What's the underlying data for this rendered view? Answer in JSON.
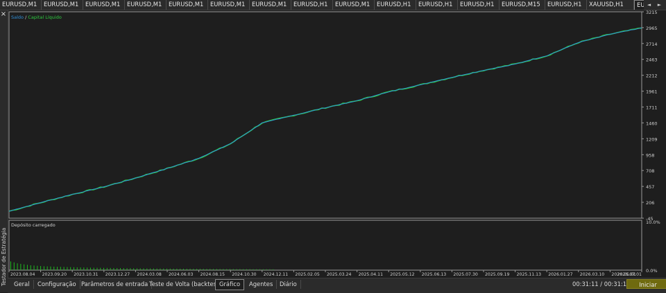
{
  "chart_tabs": [
    "EURUSD,M1",
    "EURUSD,M1",
    "EURUSD,M1",
    "EURUSD,M1",
    "EURUSD,M1",
    "EURUSD,M1",
    "EURUSD,M1",
    "EURUSD,H1",
    "EURUSD,M1",
    "EURUSD,H1",
    "EURUSD,H1",
    "EURUSD,H1",
    "EURUSD,M15",
    "EURUSD,H1",
    "XAUUSD,H1",
    "EUF"
  ],
  "active_chart_tab": 15,
  "nav": {
    "left": "◄",
    "right": "►"
  },
  "close_label": "×",
  "side_title": "Testador de Estratégia",
  "chart_data": [
    {
      "type": "line",
      "legend": [
        "Saldo",
        "Capital Líquido"
      ],
      "legend_sep": "/",
      "colors": {
        "balance": "#2f8fd8",
        "equity": "#2ecc40"
      },
      "y_ticks": [
        "3215",
        "2965",
        "2714",
        "2463",
        "2212",
        "1961",
        "1711",
        "1460",
        "1209",
        "958",
        "708",
        "457",
        "206",
        "-45"
      ],
      "ylim": [
        -45,
        3215
      ],
      "x_ticks": [
        "2023.08.04",
        "2023.09.20",
        "2023.10.31",
        "2023.12.27",
        "2024.03.08",
        "2024.06.03",
        "2024.08.15",
        "2024.10.30",
        "2024.12.11",
        "2025.02.05",
        "2025.03.24",
        "2025.04.11",
        "2025.05.12",
        "2025.06.13",
        "2025.07.30",
        "2025.09.19",
        "2025.11.13",
        "2026.01.27",
        "2026.03.10",
        "2026.05.01",
        "2026.07.01"
      ],
      "x": [
        0,
        1,
        2,
        3,
        4,
        5,
        6,
        7,
        8,
        9,
        10,
        11,
        12,
        13,
        14,
        15,
        16,
        17,
        18,
        19,
        20
      ],
      "values": [
        65,
        200,
        330,
        450,
        590,
        740,
        900,
        1130,
        1460,
        1580,
        1700,
        1810,
        1950,
        2060,
        2180,
        2290,
        2390,
        2520,
        2730,
        2860,
        2960
      ],
      "xlim": [
        0,
        20
      ]
    },
    {
      "type": "bar",
      "title": "Depósito carregado",
      "y_ticks": [
        "10.0%",
        "0.0%"
      ],
      "ylim": [
        0,
        10
      ],
      "color": "#1fb81f",
      "values": [
        1.8,
        1.6,
        1.4,
        1.3,
        1.2,
        1.1,
        1.0,
        0.95,
        0.9,
        0.85,
        0.8,
        0.78,
        0.75,
        0.72,
        0.7,
        0.68,
        0.66,
        0.64,
        0.62,
        0.6,
        0.58,
        0.56,
        0.55,
        0.53,
        0.52,
        0.5,
        0.49,
        0.48,
        0.47,
        0.46,
        0.45,
        0.44,
        0.43,
        0.42,
        0.41,
        0.4,
        0.39,
        0.38,
        0.37,
        0.36,
        0.36,
        0.35,
        0.34,
        0.34,
        0.33,
        0.33,
        0.32,
        0.31,
        0.31,
        0.3,
        0.3,
        0.29,
        0.29,
        0.28,
        0.28,
        0.27,
        0.27,
        0.26,
        0.26,
        0.25,
        0.25,
        0.24,
        0.24,
        0.23,
        0.23,
        0.22,
        0.22,
        0.22,
        0.21,
        0.21,
        0.2,
        0.2,
        0.2,
        0.19,
        0.19,
        0.18,
        0.18,
        0.18,
        0.17,
        0.17
      ]
    }
  ],
  "bottom_tabs": [
    "Geral",
    "Configuração",
    "Parâmetros de entrada",
    "Teste de Volta (backtest)",
    "Gráfico",
    "Agentes",
    "Diário"
  ],
  "active_bottom_tab": 4,
  "timer": "00:31:11 / 00:31:12",
  "start_label": "Iniciar"
}
